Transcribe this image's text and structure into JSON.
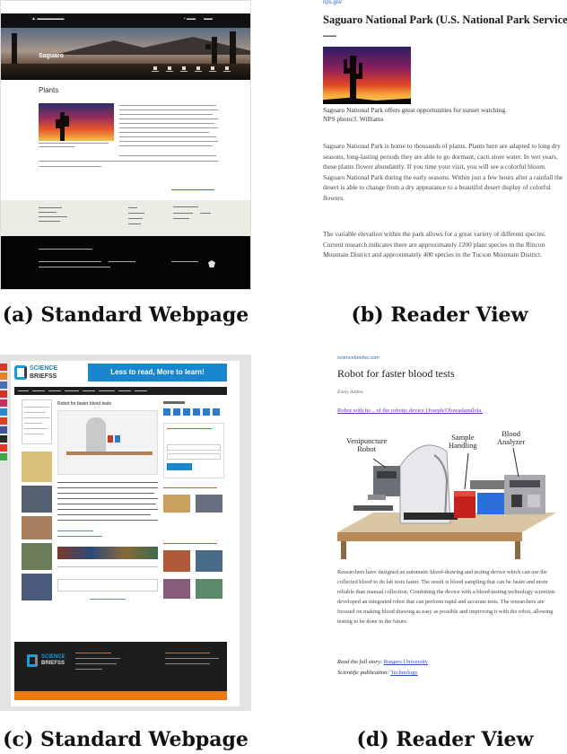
{
  "captions": {
    "a": "(a) Standard Webpage",
    "b": "(b) Reader View",
    "c": "(c) Standard Webpage",
    "d": "(d) Reader View"
  },
  "nps_page": {
    "hero_title": "Saguaro",
    "section_heading": "Plants"
  },
  "nps_reader": {
    "site": "nps.gov",
    "title": "Saguaro National Park (U.S. National Park Service)",
    "caption_line1": "Saguaro National Park offers great opportunities for sunset watching.",
    "caption_line2": "NPS photo/J. Williams",
    "paragraph1": "Saguaro National Park is home to thousands of plants. Plants here are adapted to long dry seasons, long-lasting periods they are able to go dormant; cacti store water. In wet years, these plants flower abundantly. If you time your visit, you will see a colorful bloom. Saguaro National Park during the early seasons. Within just a few hours after a rainfall the desert is able to change from a dry appearance to a beautiful desert display of colorful flowers.",
    "paragraph2": "The variable elevation within the park allows for a great variety of different species. Current research indicates there are approximately 1200 plant species in the Rincon Mountain District and approximately 400 species in the Tucson Mountain District."
  },
  "sb_page": {
    "logo_line1": "SCIENCE",
    "logo_line2": "BRIEFSS",
    "banner": "Less to read, More to learn!",
    "article_title": "Robot for faster blood tests"
  },
  "sb_reader": {
    "site": "sciencebriefss.com",
    "title": "Robot for faster blood tests",
    "author": "Emily Anthes",
    "link": "Robot with its .. of the robotic device (Joseph/Oluwadamilola et al)",
    "fig_label_venipuncture": "Venipuncture\nRobot",
    "fig_label_sample": "Sample\nHandling",
    "fig_label_blood": "Blood\nAnalyzer",
    "paragraph": "Researchers have designed an automatic blood-drawing and testing device which can use the collected blood to do lab tests faster. The result is blood sampling that can be faster and more reliable than manual collection. Combining the device with a blood-testing technology scientists developed an integrated robot that can perform rapid and accurate tests. The researchers are focused on making blood drawing as easy as possible and improving it with the robot, allowing testing to be done in the future.",
    "read_more_prefix": "Read the full story: ",
    "read_more_link": "Rutgers University",
    "journal_prefix": "Scientific publication: ",
    "journal_link": "Technology"
  },
  "colors": {
    "reader_link": "#2a6fb8",
    "visited_link": "#6d2bc4",
    "sb_blue": "#1a86d0",
    "sb_orange": "#ec7a14"
  }
}
